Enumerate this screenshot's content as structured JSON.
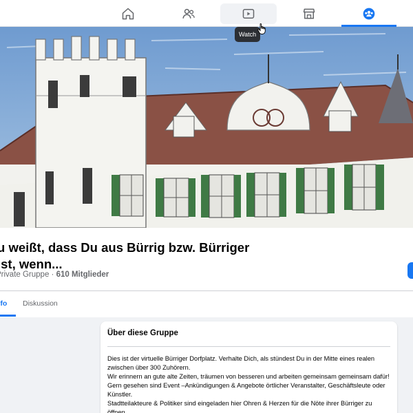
{
  "nav": {
    "tabs": [
      {
        "icon": "home-icon"
      },
      {
        "icon": "friends-icon"
      },
      {
        "icon": "watch-icon"
      },
      {
        "icon": "marketplace-icon"
      },
      {
        "icon": "groups-icon"
      }
    ],
    "active_tab": "groups",
    "hovered_tab": "watch",
    "tooltip": "Watch"
  },
  "colors": {
    "accent": "#1877f2",
    "text": "#050505",
    "secondary_text": "#65676b",
    "background": "#f0f2f5"
  },
  "group": {
    "title": "u weißt, dass Du aus Bürrig bzw. Bürriger ist, wenn...",
    "privacy": "Private Gruppe",
    "separator": " · ",
    "members": "610 Mitglieder"
  },
  "tabs": {
    "info": "nfo",
    "discussion": "Diskussion"
  },
  "about": {
    "title": "Über diese Gruppe",
    "paragraphs": [
      "Dies ist der virtuelle Bürriger Dorfplatz. Verhalte Dich, als stündest Du in der Mitte eines realen zwischen über 300 Zuhörern.",
      "Wir erinnern an gute alte Zeiten, träumen von besseren und arbeiten gemeinsam gemeinsam dafür! Gern gesehen sind Event –Ankündigungen & Angebote örtlicher Veranstalter, Geschäftsleute oder Künstler.",
      "Stadtteilakteure & Politiker sind eingeladen hier Ohren & Herzen für die Nöte ihrer Bürriger zu öffnen."
    ]
  }
}
